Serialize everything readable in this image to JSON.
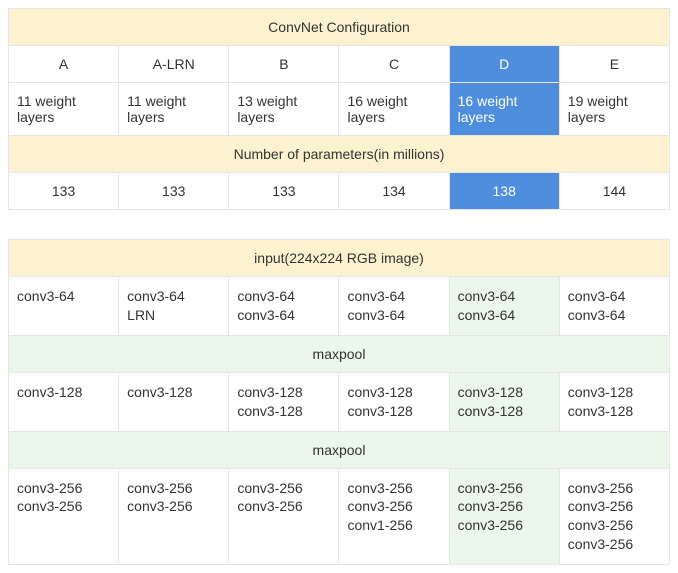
{
  "title_config": "ConvNet Configuration",
  "columns": [
    "A",
    "A-LRN",
    "B",
    "C",
    "D",
    "E"
  ],
  "weight_layers": [
    "11 weight layers",
    "11 weight layers",
    "13 weight layers",
    "16 weight layers",
    "16 weight layers",
    "19 weight layers"
  ],
  "title_params": "Number of parameters(in millions)",
  "params": [
    "133",
    "133",
    "133",
    "134",
    "138",
    "144"
  ],
  "title_input": "input(224x224 RGB image)",
  "block1": {
    "A": [
      "conv3-64"
    ],
    "A_LRN": [
      "conv3-64",
      "LRN"
    ],
    "B": [
      "conv3-64",
      "conv3-64"
    ],
    "C": [
      "conv3-64",
      "conv3-64"
    ],
    "D": [
      "conv3-64",
      "conv3-64"
    ],
    "E": [
      "conv3-64",
      "conv3-64"
    ]
  },
  "maxpool1": "maxpool",
  "block2": {
    "A": [
      "conv3-128"
    ],
    "A_LRN": [
      "conv3-128"
    ],
    "B": [
      "conv3-128",
      "conv3-128"
    ],
    "C": [
      "conv3-128",
      "conv3-128"
    ],
    "D": [
      "conv3-128",
      "conv3-128"
    ],
    "E": [
      "conv3-128",
      "conv3-128"
    ]
  },
  "maxpool2": "maxpool",
  "block3": {
    "A": [
      "conv3-256",
      "conv3-256"
    ],
    "A_LRN": [
      "conv3-256",
      "conv3-256"
    ],
    "B": [
      "conv3-256",
      "conv3-256"
    ],
    "C": [
      "conv3-256",
      "conv3-256",
      "conv1-256"
    ],
    "D": [
      "conv3-256",
      "conv3-256",
      "conv3-256"
    ],
    "E": [
      "conv3-256",
      "conv3-256",
      "conv3-256",
      "conv3-256"
    ]
  },
  "chart_data": {
    "type": "table",
    "title": "ConvNet Configuration",
    "columns": [
      "A",
      "A-LRN",
      "B",
      "C",
      "D",
      "E"
    ],
    "rows": [
      {
        "label": "weight layers",
        "values": [
          11,
          11,
          13,
          16,
          16,
          19
        ]
      },
      {
        "label": "parameters (millions)",
        "values": [
          133,
          133,
          133,
          134,
          138,
          144
        ]
      }
    ],
    "highlighted_column": "D",
    "input": "224x224 RGB image",
    "architecture": {
      "A": [
        [
          "conv3-64"
        ],
        "maxpool",
        [
          "conv3-128"
        ],
        "maxpool",
        [
          "conv3-256",
          "conv3-256"
        ]
      ],
      "A-LRN": [
        [
          "conv3-64",
          "LRN"
        ],
        "maxpool",
        [
          "conv3-128"
        ],
        "maxpool",
        [
          "conv3-256",
          "conv3-256"
        ]
      ],
      "B": [
        [
          "conv3-64",
          "conv3-64"
        ],
        "maxpool",
        [
          "conv3-128",
          "conv3-128"
        ],
        "maxpool",
        [
          "conv3-256",
          "conv3-256"
        ]
      ],
      "C": [
        [
          "conv3-64",
          "conv3-64"
        ],
        "maxpool",
        [
          "conv3-128",
          "conv3-128"
        ],
        "maxpool",
        [
          "conv3-256",
          "conv3-256",
          "conv1-256"
        ]
      ],
      "D": [
        [
          "conv3-64",
          "conv3-64"
        ],
        "maxpool",
        [
          "conv3-128",
          "conv3-128"
        ],
        "maxpool",
        [
          "conv3-256",
          "conv3-256",
          "conv3-256"
        ]
      ],
      "E": [
        [
          "conv3-64",
          "conv3-64"
        ],
        "maxpool",
        [
          "conv3-128",
          "conv3-128"
        ],
        "maxpool",
        [
          "conv3-256",
          "conv3-256",
          "conv3-256",
          "conv3-256"
        ]
      ]
    }
  }
}
